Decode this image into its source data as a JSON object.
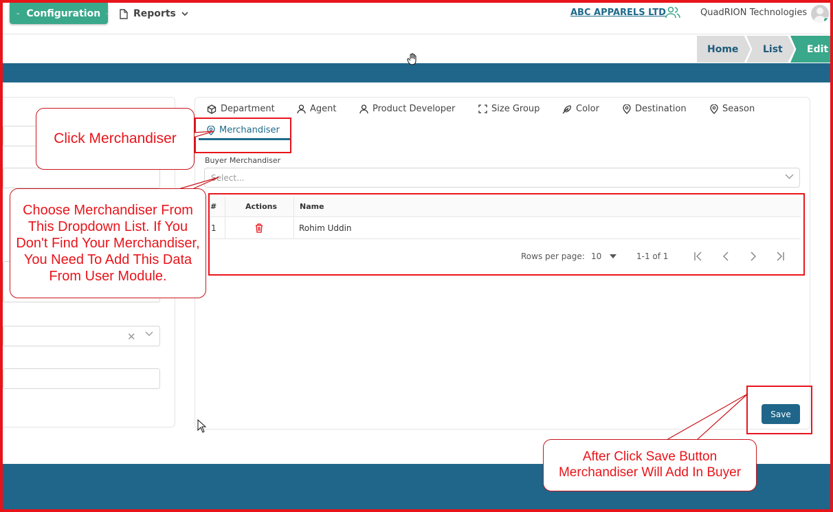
{
  "topnav": {
    "config_label": "Configuration",
    "reports_label": "Reports",
    "company": "ABC APPARELS LTD",
    "org": "QuadRION Technologies"
  },
  "breadcrumb": [
    "Home",
    "List",
    "Edit"
  ],
  "tabs": [
    {
      "label": "Department",
      "icon": "box-icon"
    },
    {
      "label": "Agent",
      "icon": "user-icon"
    },
    {
      "label": "Product Developer",
      "icon": "user-icon"
    },
    {
      "label": "Size Group",
      "icon": "expand-icon"
    },
    {
      "label": "Color",
      "icon": "feather-icon"
    },
    {
      "label": "Destination",
      "icon": "map-pin-icon"
    },
    {
      "label": "Season",
      "icon": "map-pin-icon"
    },
    {
      "label": "Merchandiser",
      "icon": "map-pin-icon",
      "active": true
    }
  ],
  "form": {
    "field_label": "Buyer Merchandiser",
    "select_placeholder": "Select..."
  },
  "table": {
    "headers": [
      "#",
      "Actions",
      "Name"
    ],
    "rows": [
      {
        "index": "1",
        "name": "Rohim Uddin"
      }
    ]
  },
  "pagination": {
    "rows_label": "Rows per page:",
    "rows_value": "10",
    "range": "1-1 of 1"
  },
  "save_label": "Save",
  "annotations": {
    "click": "Click Merchandiser",
    "choose": "Choose Merchandiser From This Dropdown List. If You Don't Find Your Merchandiser, You Need To Add This Data From User Module.",
    "after": "After Click Save Button Merchandiser Will Add In Buyer"
  },
  "colors": {
    "brand_green": "#3aa88a",
    "brand_blue": "#20668a",
    "annotation_red": "#e8141a"
  }
}
